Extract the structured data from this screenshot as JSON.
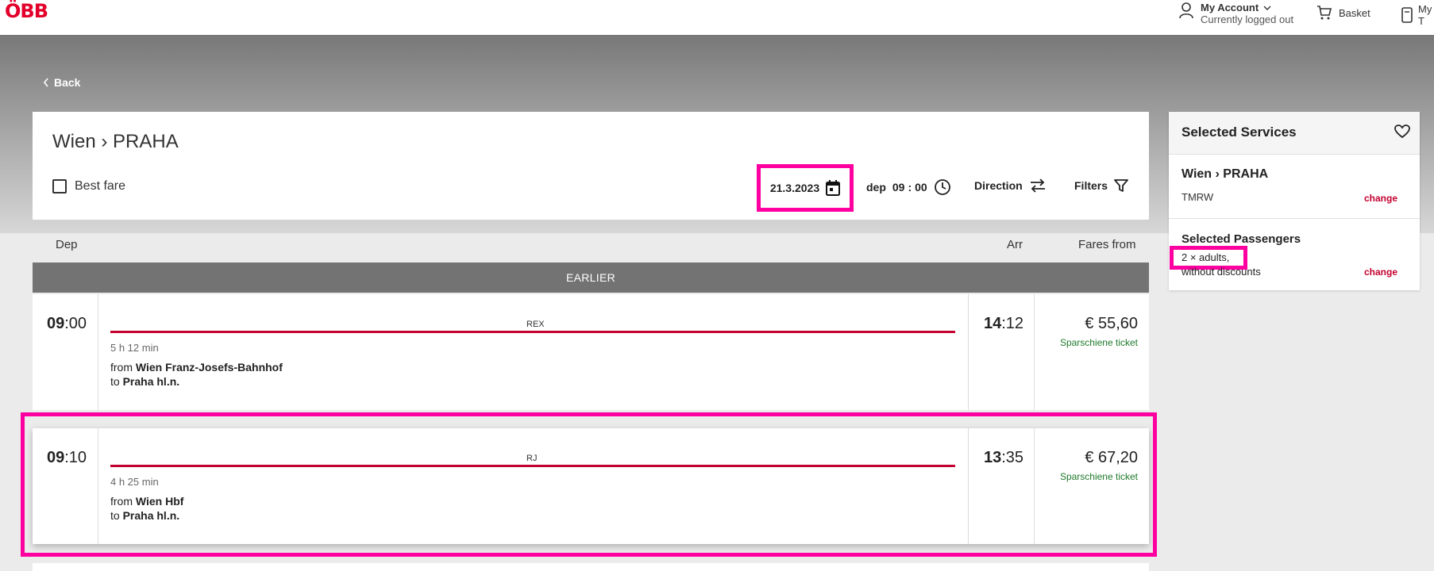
{
  "header": {
    "logo": "ÖBB",
    "account_label": "My Account",
    "account_status": "Currently logged out",
    "basket_label": "Basket",
    "my_tickets_label": "My T"
  },
  "nav": {
    "back_label": "Back"
  },
  "search": {
    "route": "Wien › PRAHA",
    "best_fare_label": "Best fare",
    "date": "21.3.2023",
    "dep_label": "dep",
    "dep_hour": "09",
    "dep_minute": "00",
    "direction_label": "Direction",
    "filters_label": "Filters"
  },
  "columns": {
    "dep": "Dep",
    "arr": "Arr",
    "fares": "Fares from"
  },
  "earlier_label": "EARLIER",
  "connections": [
    {
      "dep_hour": "09",
      "dep_min": ":00",
      "train_type": "REX",
      "duration": "5 h 12 min",
      "from_prefix": "from",
      "from_station": "Wien Franz-Josefs-Bahnhof",
      "to_prefix": "to",
      "to_station": "Praha hl.n.",
      "arr_hour": "14",
      "arr_min": ":12",
      "price": "€ 55,60",
      "price_type": "Sparschiene ticket"
    },
    {
      "dep_hour": "09",
      "dep_min": ":10",
      "train_type": "RJ",
      "duration": "4 h 25 min",
      "from_prefix": "from",
      "from_station": "Wien Hbf",
      "to_prefix": "to",
      "to_station": "Praha hl.n.",
      "arr_hour": "13",
      "arr_min": ":35",
      "price": "€ 67,20",
      "price_type": "Sparschiene ticket"
    }
  ],
  "selected": {
    "title": "Selected Services",
    "route": "Wien › PRAHA",
    "date_label": "TMRW",
    "change_label": "change",
    "pax_title": "Selected Passengers",
    "pax_count": "2 × adults,",
    "pax_discount": "without discounts",
    "change_label_2": "change"
  },
  "colors": {
    "brand": "#e2002a",
    "accent_red": "#c3002f",
    "highlight": "#ff00a0",
    "green": "#1f7a2c"
  }
}
